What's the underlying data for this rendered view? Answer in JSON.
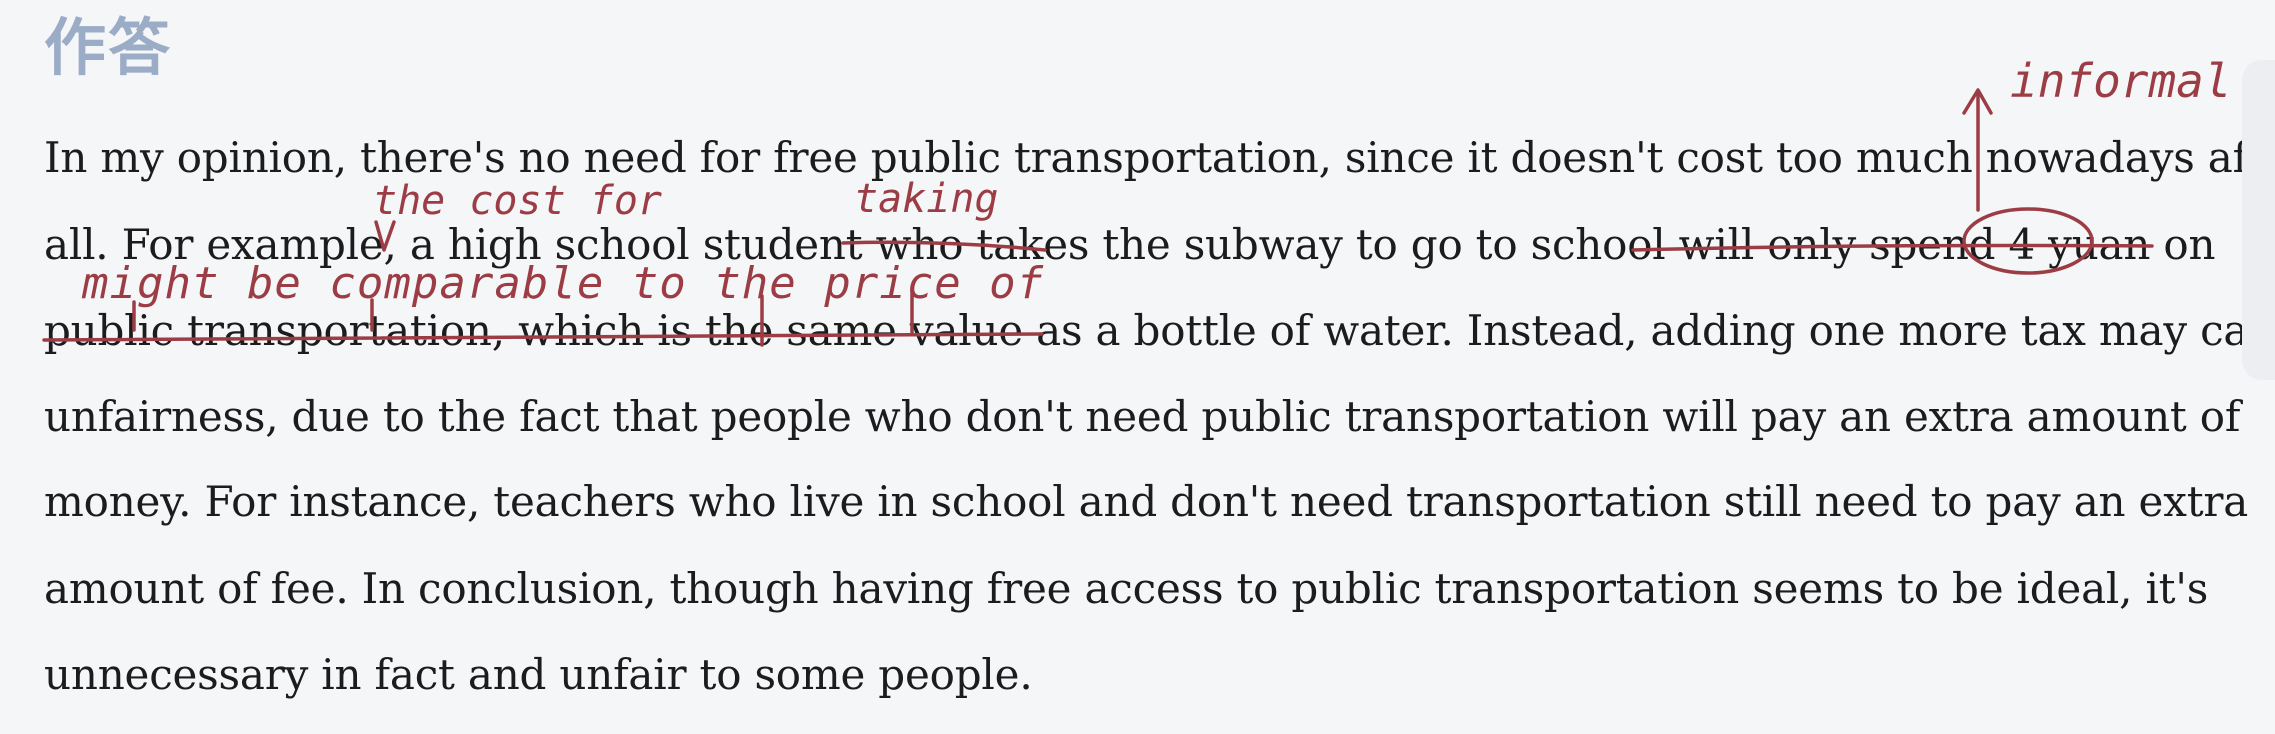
{
  "heading": "作答",
  "essay_lines": [
    "In my opinion, there's no need for free public transportation, since it doesn't cost too much nowadays after",
    "all. For example, a high school student who takes the subway to go to school will only spend 4 yuan on",
    "public transportation, which is the same value as a bottle of water. Instead, adding one more tax may cause",
    "unfairness, due to the fact that people who don't need public transportation will pay an extra amount of",
    "money. For instance, teachers who live in school and don't need transportation still need to pay an extra",
    "amount of fee. In conclusion, though having free access to public transportation seems to be ideal, it's",
    "unnecessary in fact and unfair to some people."
  ],
  "annotations": {
    "informal": "informal",
    "the_cost_for": "the cost for",
    "taking": "taking",
    "comparable": "might be comparable to the price of"
  },
  "colors": {
    "heading": "#9bacc6",
    "ink": "#9c3d45",
    "text": "#1c1c1c",
    "background": "#f5f6f8"
  }
}
